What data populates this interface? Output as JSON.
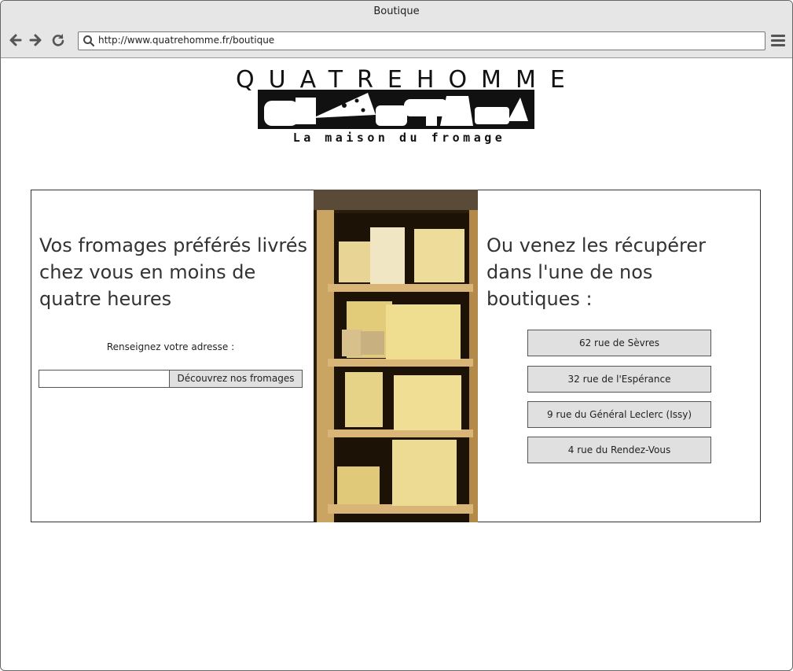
{
  "window": {
    "title": "Boutique"
  },
  "browser": {
    "url": "http://www.quatrehomme.fr/boutique",
    "back_icon": "arrow-left-icon",
    "forward_icon": "arrow-right-icon",
    "reload_icon": "reload-icon",
    "search_icon": "search-icon",
    "menu_icon": "hamburger-menu-icon"
  },
  "logo": {
    "word": "QUATREHOMME",
    "tagline": "La maison du fromage"
  },
  "delivery": {
    "heading": "Vos fromages préférés livrés chez vous en moins de quatre heures",
    "address_label": "Renseignez votre adresse :",
    "address_value": "",
    "button_label": "Découvrez nos fromages"
  },
  "stores": {
    "heading": "Ou venez les récupérer dans l'une de nos boutiques :",
    "items": [
      {
        "label": "62 rue de Sèvres"
      },
      {
        "label": "32 rue de l'Espérance"
      },
      {
        "label": "9 rue du Général Leclerc (Issy)"
      },
      {
        "label": "4 rue du Rendez-Vous"
      }
    ]
  },
  "colors": {
    "chrome": "#e6e6e6",
    "button": "#e0e0e0",
    "border": "#555555",
    "text": "#333333"
  }
}
